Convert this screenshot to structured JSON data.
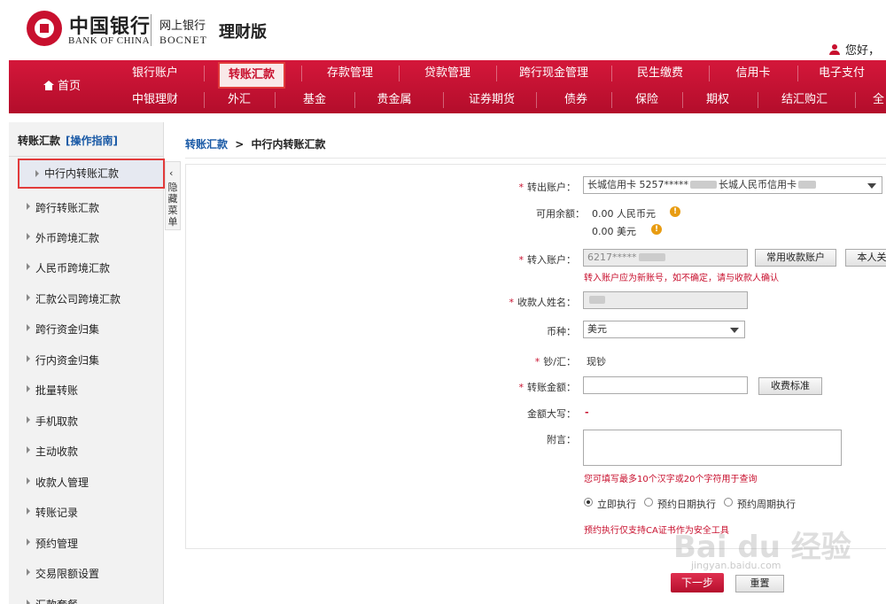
{
  "header": {
    "bank_cn": "中国银行",
    "bank_en": "BANK OF CHINA",
    "netbank_cn": "网上银行",
    "netbank_en": "BOCNET",
    "edition": "理财版",
    "greeting": "您好，"
  },
  "nav": {
    "home": "首页",
    "row1": [
      "银行账户",
      "转账汇款",
      "存款管理",
      "贷款管理",
      "跨行现金管理",
      "民生缴费",
      "信用卡",
      "电子支付"
    ],
    "row2": [
      "中银理财",
      "外汇",
      "基金",
      "贵金属",
      "证券期货",
      "债券",
      "保险",
      "期权",
      "结汇购汇",
      "全"
    ],
    "active": "转账汇款"
  },
  "sidebar": {
    "title": "转账汇款",
    "guide": "[操作指南]",
    "items": [
      "中行内转账汇款",
      "跨行转账汇款",
      "外币跨境汇款",
      "人民币跨境汇款",
      "汇款公司跨境汇款",
      "跨行资金归集",
      "行内资金归集",
      "批量转账",
      "手机取款",
      "主动收款",
      "收款人管理",
      "转账记录",
      "预约管理",
      "交易限额设置",
      "汇款套餐"
    ],
    "active": "中行内转账汇款",
    "collapse_label": "隐藏菜单"
  },
  "breadcrumb": {
    "root": "转账汇款",
    "sep": ">",
    "current": "中行内转账汇款"
  },
  "form": {
    "from_account_label": "转出账户：",
    "from_account_value_a": "长城信用卡  5257*****",
    "from_account_value_b": "长城人民币信用卡",
    "balance_label": "可用余额：",
    "balance_cny": "0.00  人民币元",
    "balance_usd": "0.00  美元",
    "to_account_label": "转入账户：",
    "to_account_value": "6217*****",
    "common_payee_btn": "常用收款账户",
    "own_account_btn": "本人关",
    "to_account_hint": "转入账户应为新账号，如不确定，请与收款人确认",
    "payee_name_label": "收款人姓名：",
    "currency_label": "币种：",
    "currency_value": "美元",
    "cash_label": "钞/汇：",
    "cash_value": "现钞",
    "amount_label": "转账金额：",
    "fee_btn": "收费标准",
    "amount_caps_label": "金额大写：",
    "amount_caps_value": "-",
    "memo_label": "附言：",
    "memo_hint": "您可填写最多10个汉字或20个字符用于查询",
    "exec_options": [
      "立即执行",
      "预约日期执行",
      "预约周期执行"
    ],
    "exec_selected": "立即执行",
    "exec_hint": "预约执行仅支持CA证书作为安全工具",
    "next_btn": "下一步",
    "reset_btn": "重置",
    "required_mark": "*"
  },
  "watermark": {
    "main": "Bai du 经验",
    "sub": "jingyan.baidu.com"
  },
  "colors": {
    "brand_red": "#c8102e",
    "link_blue": "#1a5aa6",
    "info_orange": "#e89c12"
  }
}
